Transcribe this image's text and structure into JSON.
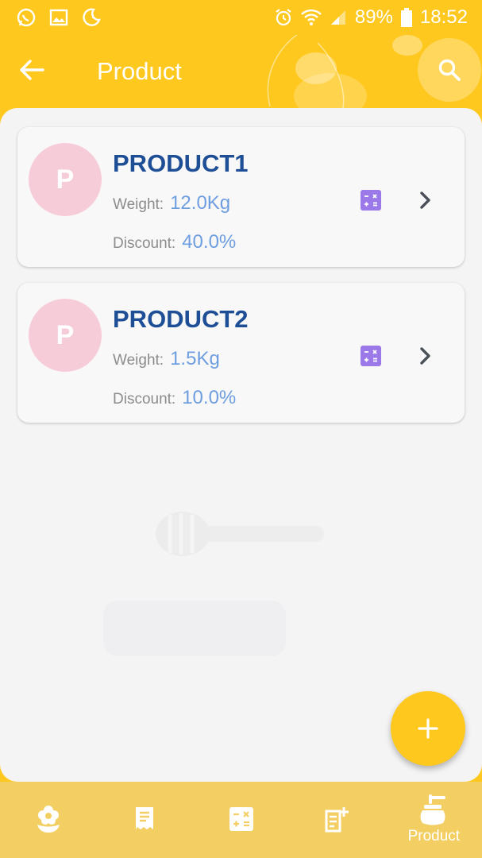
{
  "status_bar": {
    "battery": "89%",
    "time": "18:52",
    "icons": [
      "whatsapp-icon",
      "image-icon",
      "moon-clock-icon",
      "alarm-icon",
      "wifi-icon",
      "signal-icon",
      "battery-icon"
    ]
  },
  "header": {
    "title": "Product",
    "back_icon": "arrow-left-icon",
    "search_icon": "search-icon"
  },
  "products": [
    {
      "avatar_letter": "P",
      "name": "PRODUCT1",
      "weight_label": "Weight:",
      "weight_value": "12.0Kg",
      "discount_label": "Discount:",
      "discount_value": "40.0%"
    },
    {
      "avatar_letter": "P",
      "name": "PRODUCT2",
      "weight_label": "Weight:",
      "weight_value": "1.5Kg",
      "discount_label": "Discount:",
      "discount_value": "10.0%"
    }
  ],
  "fab": {
    "icon": "plus-icon"
  },
  "bottom_nav": {
    "items": [
      {
        "icon": "flower-icon",
        "label": ""
      },
      {
        "icon": "receipt-icon",
        "label": ""
      },
      {
        "icon": "calculator-icon",
        "label": ""
      },
      {
        "icon": "note-add-icon",
        "label": ""
      },
      {
        "icon": "honey-pot-icon",
        "label": "Product"
      }
    ],
    "active_index": 4
  },
  "colors": {
    "primary": "#FFC81E",
    "bottom_nav": "#F3CF63",
    "product_name": "#1E4F96",
    "value_text": "#6E9EE0",
    "avatar_bg": "#F7CCD9",
    "calc_icon": "#9C79E8"
  }
}
